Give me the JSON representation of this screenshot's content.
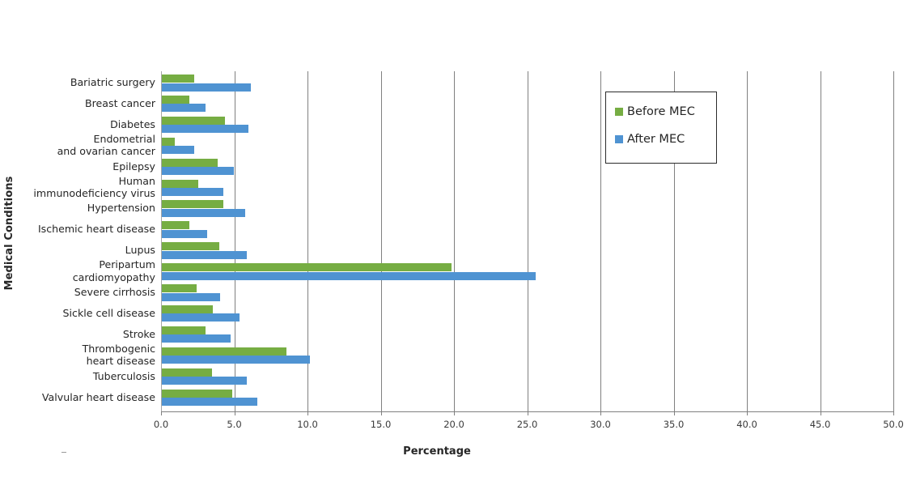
{
  "chart_data": {
    "type": "bar",
    "orientation": "horizontal",
    "title": "",
    "xlabel": "Percentage",
    "ylabel": "Medical Conditions",
    "xlim": [
      0,
      50
    ],
    "xticks": [
      "0.0",
      "5.0",
      "10.0",
      "15.0",
      "20.0",
      "25.0",
      "30.0",
      "35.0",
      "40.0",
      "45.0",
      "50.0"
    ],
    "xtick_values": [
      0,
      5,
      10,
      15,
      20,
      25,
      30,
      35,
      40,
      45,
      50
    ],
    "grid": "vertical",
    "legend_position": "upper-right",
    "categories": [
      "Bariatric surgery",
      "Breast cancer",
      "Diabetes",
      "Endometrial\nand ovarian cancer",
      "Epilepsy",
      "Human\nimmunodeficiency virus",
      "Hypertension",
      "Ischemic heart disease",
      "Lupus",
      "Peripartum\ncardiomyopathy",
      "Severe cirrhosis",
      "Sickle cell disease",
      "Stroke",
      "Thrombogenic\nheart disease",
      "Tuberculosis",
      "Valvular heart disease"
    ],
    "series": [
      {
        "name": "Before MEC",
        "color": "#76ad43",
        "values": [
          2.2,
          1.9,
          4.3,
          0.9,
          3.8,
          2.5,
          4.2,
          1.9,
          3.9,
          19.8,
          2.4,
          3.5,
          3.0,
          8.5,
          3.4,
          4.8
        ]
      },
      {
        "name": "After MEC",
        "color": "#4f93d2",
        "values": [
          6.1,
          3.0,
          5.9,
          2.2,
          4.9,
          4.2,
          5.7,
          3.1,
          5.8,
          25.5,
          4.0,
          5.3,
          4.7,
          10.1,
          5.8,
          6.5
        ]
      }
    ]
  },
  "legend": {
    "items": [
      {
        "label": "Before MEC",
        "color": "#76ad43"
      },
      {
        "label": "After MEC",
        "color": "#4f93d2"
      }
    ]
  },
  "axes": {
    "x_title": "Percentage",
    "y_title": "Medical Conditions"
  }
}
